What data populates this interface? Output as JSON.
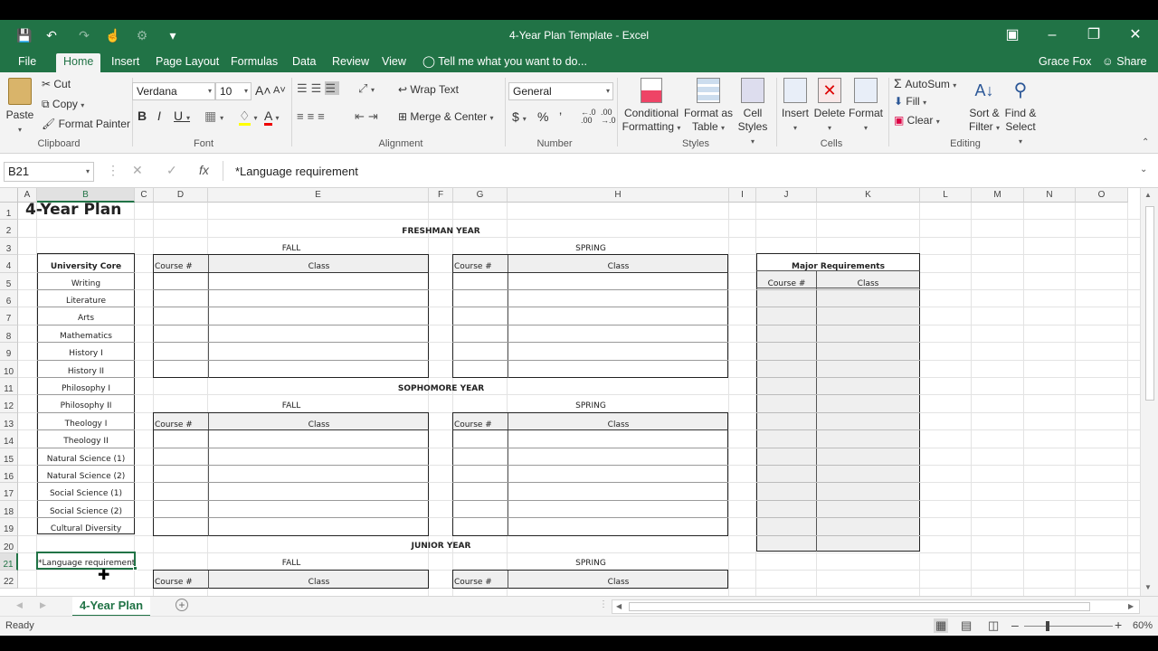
{
  "window": {
    "title": "4-Year Plan Template - Excel",
    "user": "Grace Fox",
    "share": "Share"
  },
  "tabs": [
    "File",
    "Home",
    "Insert",
    "Page Layout",
    "Formulas",
    "Data",
    "Review",
    "View"
  ],
  "tell_me": "Tell me what you want to do...",
  "ribbon": {
    "clipboard": {
      "paste": "Paste",
      "cut": "Cut",
      "copy": "Copy",
      "format_painter": "Format Painter",
      "label": "Clipboard"
    },
    "font": {
      "name": "Verdana",
      "size": "10",
      "label": "Font"
    },
    "alignment": {
      "wrap_text": "Wrap Text",
      "merge_center": "Merge & Center",
      "label": "Alignment"
    },
    "number": {
      "format": "General",
      "label": "Number"
    },
    "styles": {
      "conditional": "Conditional",
      "formatting": "Formatting",
      "format_as": "Format as",
      "table": "Table",
      "cell": "Cell",
      "styles": "Styles",
      "label": "Styles"
    },
    "cells": {
      "insert": "Insert",
      "delete": "Delete",
      "format": "Format",
      "label": "Cells"
    },
    "editing": {
      "autosum": "AutoSum",
      "fill": "Fill",
      "clear": "Clear",
      "sort": "Sort &",
      "filter": "Filter",
      "find": "Find &",
      "select": "Select",
      "label": "Editing"
    }
  },
  "formula_bar": {
    "name_box": "B21",
    "formula": "*Language requirement"
  },
  "columns": [
    "A",
    "B",
    "C",
    "D",
    "E",
    "F",
    "G",
    "H",
    "I",
    "J",
    "K",
    "L",
    "M",
    "N",
    "O"
  ],
  "rows": [
    "1",
    "2",
    "3",
    "4",
    "5",
    "6",
    "7",
    "8",
    "9",
    "10",
    "11",
    "12",
    "13",
    "14",
    "15",
    "16",
    "17",
    "18",
    "19",
    "20",
    "21",
    "22"
  ],
  "sheet": {
    "title": "4-Year Plan",
    "freshman": "FRESHMAN YEAR",
    "sophomore": "SOPHOMORE YEAR",
    "junior": "JUNIOR YEAR",
    "fall": "FALL",
    "spring": "SPRING",
    "course_num": "Course #",
    "class": "Class",
    "university_core": "University Core",
    "core_items": [
      "Writing",
      "Literature",
      "Arts",
      "Mathematics",
      "History I",
      "History II",
      "Philosophy I",
      "Philosophy II",
      "Theology I",
      "Theology II",
      "Natural Science (1)",
      "Natural Science (2)",
      "Social Science (1)",
      "Social Science (2)",
      "Cultural Diversity"
    ],
    "language_req": "*Language requirement",
    "major_req": "Major Requirements"
  },
  "sheet_tab": "4-Year Plan",
  "status": {
    "ready": "Ready",
    "zoom": "60%"
  },
  "colors": {
    "excel_green": "#217346",
    "ribbon_bg": "#f3f3f3"
  }
}
